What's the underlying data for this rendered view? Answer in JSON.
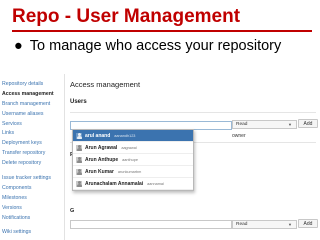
{
  "slide": {
    "title": "Repo - User Management",
    "bullet_symbol": "●",
    "bullet_text": "To manage who access your repository"
  },
  "sidebar": {
    "items": [
      "Repository details",
      "Access management",
      "Branch management",
      "Username aliases",
      "Services",
      "Links",
      "Deployment keys",
      "Transfer repository",
      "Delete repository",
      "Issue tracker settings",
      "Components",
      "Milestones",
      "Versions",
      "Notifications",
      "Wiki settings"
    ],
    "active_index": 1
  },
  "main": {
    "title": "Access management",
    "users_label": "Users",
    "user_permission": "Read",
    "add_label": "Add",
    "owner_label": "owner",
    "permissions_initial": "P",
    "groups_initial": "G",
    "group_permission": "Read",
    "group_add_label": "Add"
  },
  "dropdown": {
    "items": [
      {
        "name": "arul anand",
        "user": "aanandh123",
        "highlighted": true
      },
      {
        "name": "Arun Agrawal",
        "user": "aagrawal",
        "highlighted": false
      },
      {
        "name": "Arun Anthupe",
        "user": "aanthupe",
        "highlighted": false
      },
      {
        "name": "Arun Kumar",
        "user": "arunkumarbm",
        "highlighted": false
      },
      {
        "name": "Arunachalam Annamalai",
        "user": "aannamal",
        "highlighted": false
      }
    ]
  },
  "colors": {
    "title_red": "#c00000",
    "link_blue": "#3b73af",
    "highlight_blue": "#3b73af"
  }
}
